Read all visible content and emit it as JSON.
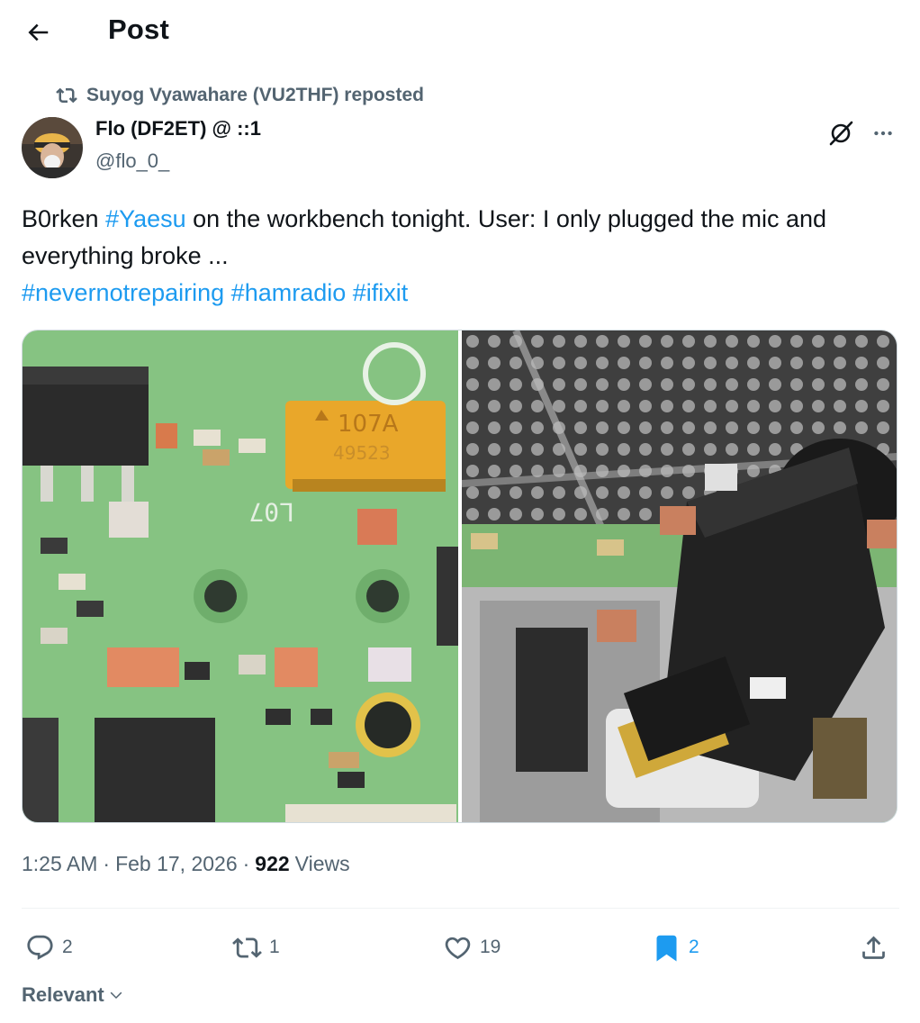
{
  "header": {
    "title": "Post"
  },
  "repost": {
    "text": "Suyog Vyawahare (VU2THF) reposted"
  },
  "author": {
    "name": "Flo (DF2ET) @ ::1",
    "handle": "@flo_0_"
  },
  "tweet": {
    "part1": "B0rken ",
    "tag_yaesu": "#Yaesu",
    "part2": " on the workbench tonight. User: I only plugged the mic and everything broke ...",
    "tag_nevernot": "#nevernotrepairing",
    "tag_hamradio": "#hamradio",
    "tag_ifixit": "#ifixit"
  },
  "media": {
    "left_chip_top": "107A",
    "left_chip_bottom": "49523",
    "left_silk": "L07"
  },
  "meta": {
    "time": "1:25 AM",
    "sep1": "·",
    "date": "Feb 17, 2026",
    "sep2": "·",
    "views_count": "922",
    "views_label": "Views"
  },
  "actions": {
    "replies": "2",
    "reposts": "1",
    "likes": "19",
    "bookmarks": "2"
  },
  "sort": {
    "label": "Relevant"
  },
  "colors": {
    "accent": "#1d9bf0",
    "secondary_text": "#536471",
    "primary_text": "#0f1419"
  }
}
